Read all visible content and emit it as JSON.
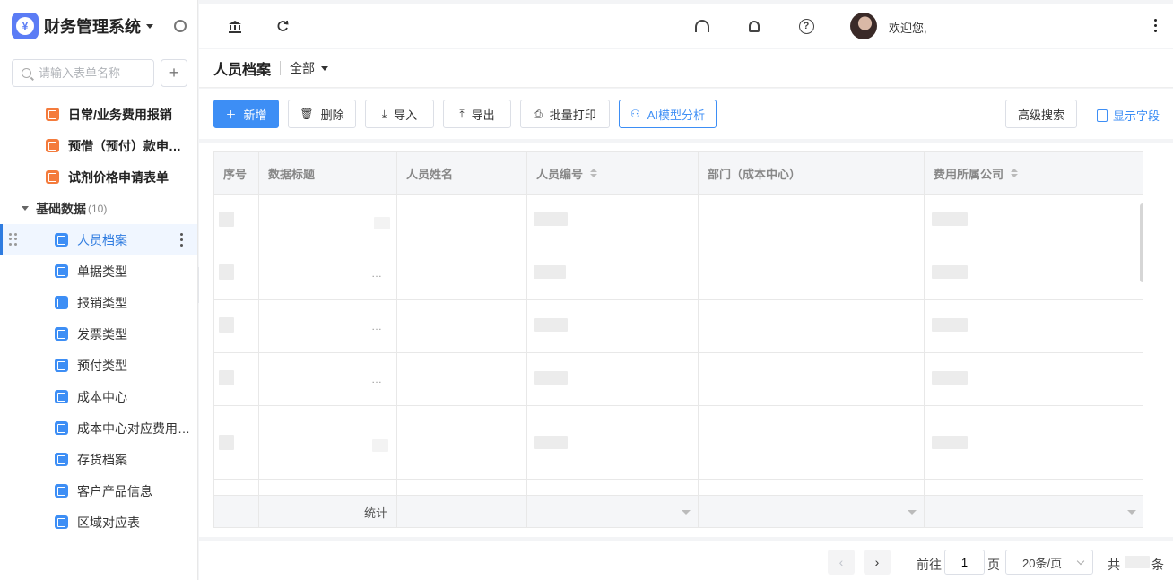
{
  "brand": {
    "title": "财务管理系统",
    "logo_glyph": "¥"
  },
  "sidebar": {
    "search_placeholder": "请输入表单名称",
    "add_label": "+",
    "top_items": [
      {
        "label": "日常/业务费用报销"
      },
      {
        "label": "预借（预付）款申…"
      },
      {
        "label": "试剂价格申请表单"
      }
    ],
    "group": {
      "label": "基础数据",
      "count": "(10)"
    },
    "items": [
      {
        "label": "人员档案"
      },
      {
        "label": "单据类型"
      },
      {
        "label": "报销类型"
      },
      {
        "label": "发票类型"
      },
      {
        "label": "预付类型"
      },
      {
        "label": "成本中心"
      },
      {
        "label": "成本中心对应费用…"
      },
      {
        "label": "存货档案"
      },
      {
        "label": "客户产品信息"
      },
      {
        "label": "区域对应表"
      }
    ]
  },
  "topbar": {
    "welcome": "欢迎您,"
  },
  "page": {
    "title": "人员档案",
    "filter": "全部"
  },
  "toolbar": {
    "new": "新增",
    "delete": "删除",
    "import": "导入",
    "export": "导出",
    "batch_print": "批量打印",
    "ai_analysis": "AI模型分析",
    "advanced_search": "高级搜索",
    "show_fields": "显示字段"
  },
  "table": {
    "headers": [
      "序号",
      "数据标题",
      "人员姓名",
      "人员编号",
      "部门（成本中心）",
      "费用所属公司"
    ],
    "footer_label": "统计"
  },
  "pagination": {
    "goto_label": "前往",
    "page_value": "1",
    "page_unit": "页",
    "page_size": "20条/页",
    "total_prefix": "共",
    "total_suffix": "条"
  },
  "colors": {
    "accent": "#3d8ef5",
    "brand_logo": "#5b7cf5",
    "form_icon": "#f47b3c"
  }
}
